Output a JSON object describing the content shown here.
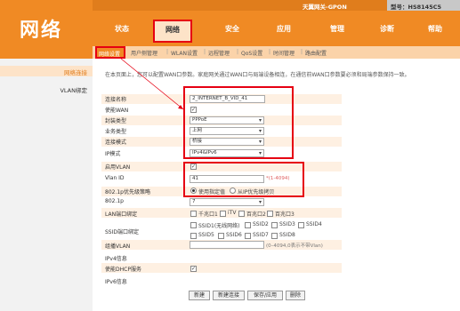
{
  "header": {
    "page_title": "网络",
    "gateway_name": "天翼网关-GPON",
    "model": "型号：HS8145C5"
  },
  "nav": {
    "items": [
      "状态",
      "网络",
      "安全",
      "应用",
      "管理",
      "诊断",
      "帮助"
    ],
    "active": "网络"
  },
  "subnav": {
    "items": [
      "网络设置",
      "用户侧管理",
      "WLAN设置",
      "远程管理",
      "QoS设置",
      "时间管理",
      "路由配置"
    ]
  },
  "sidebar": {
    "items": [
      "网络连接",
      "VLAN绑定"
    ]
  },
  "description": "在本页面上，您可以配置WAN口参数。家庭网关通过WAN口与局端设备相连，在通信前WAN口参数要必须和局端参数保持一致。",
  "form": {
    "connection_name": {
      "label": "连接名称",
      "value": "2_INTERNET_B_VID_41"
    },
    "enable_wan": {
      "label": "使能WAN",
      "checked": true
    },
    "encap_type": {
      "label": "封装类型",
      "value": "PPPoE"
    },
    "service_type": {
      "label": "业务类型",
      "value": "上网"
    },
    "conn_mode": {
      "label": "连接模式",
      "value": "桥接"
    },
    "ip_mode": {
      "label": "IP模式",
      "value": "IPv4&IPv6"
    },
    "enable_vlan": {
      "label": "启用VLAN",
      "checked": true
    },
    "vlan_id": {
      "label": "Vlan ID",
      "value": "41",
      "hint": "*(1-4094)"
    },
    "dot1p_policy": {
      "label": "802.1p优先级策略",
      "opt1": "使用指定值",
      "opt2": "从IP优先级拷贝"
    },
    "dot1p": {
      "label": "802.1p",
      "value": "7"
    },
    "lan_bind": {
      "label": "LAN端口绑定",
      "ports": [
        "千兆口1",
        "iTV",
        "百兆口2",
        "百兆口3"
      ]
    },
    "ssid_bind": {
      "label": "SSID端口绑定",
      "row1": [
        "SSID1(无线网络)",
        "SSID2",
        "SSID3",
        "SSID4"
      ],
      "row2": [
        "SSID5",
        "SSID6",
        "SSID7",
        "SSID8"
      ]
    },
    "multicast_vlan": {
      "label": "组播VLAN",
      "hint": "(0–4094,0表示不带Vlan)"
    },
    "ipv4_info": {
      "label": "IPv4信息"
    },
    "enable_dhcp": {
      "label": "使能DHCP服务",
      "checked": true
    },
    "ipv6_info": {
      "label": "IPv6信息"
    }
  },
  "buttons": {
    "new": "新建",
    "new_conn": "新建连接",
    "save": "保存/应用",
    "delete": "删除"
  },
  "colors": {
    "brand_orange": "#f08a24",
    "highlight_red": "#e60012",
    "row_tint": "#fef0e2"
  }
}
